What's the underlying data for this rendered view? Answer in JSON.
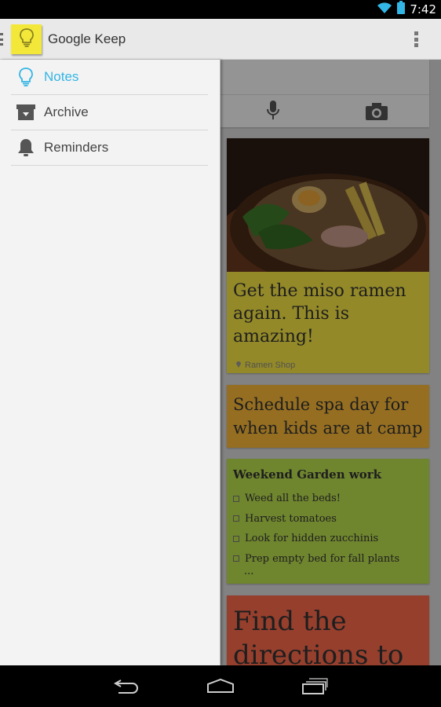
{
  "status_bar": {
    "time": "7:42",
    "icons": [
      "wifi-icon",
      "battery-icon"
    ]
  },
  "action_bar": {
    "title": "Google Keep",
    "app_icon": "lightbulb-icon",
    "menu_icon": "overflow-menu-icon"
  },
  "drawer": {
    "items": [
      {
        "label": "Notes",
        "icon": "lightbulb-icon",
        "active": true
      },
      {
        "label": "Archive",
        "icon": "archive-icon",
        "active": false
      },
      {
        "label": "Reminders",
        "icon": "bell-icon",
        "active": false
      }
    ]
  },
  "note_input": {
    "icons": [
      "microphone-icon",
      "camera-icon"
    ]
  },
  "notes": [
    {
      "type": "photo",
      "title": "Get the miso ramen again. This is amazing!",
      "location": "Ramen Shop",
      "color": "#f5e543"
    },
    {
      "type": "text",
      "title": "Schedule spa day for when kids are at camp",
      "color": "#f8b738"
    },
    {
      "type": "checklist",
      "title": "Weekend Garden work",
      "items": [
        "Weed all the beds!",
        "Harvest tomatoes",
        "Look for hidden zucchinis",
        "Prep empty bed for fall plants"
      ],
      "more": "...",
      "color": "#b9de4d"
    },
    {
      "type": "text",
      "title": "Find the directions to",
      "color": "#fa6a4c"
    }
  ],
  "colors": {
    "accent": "#33b5e5",
    "drawer_bg": "#f3f3f3",
    "action_bar_bg": "#e9e9e9"
  },
  "nav_bar": {
    "buttons": [
      "back-icon",
      "home-icon",
      "recents-icon"
    ]
  }
}
